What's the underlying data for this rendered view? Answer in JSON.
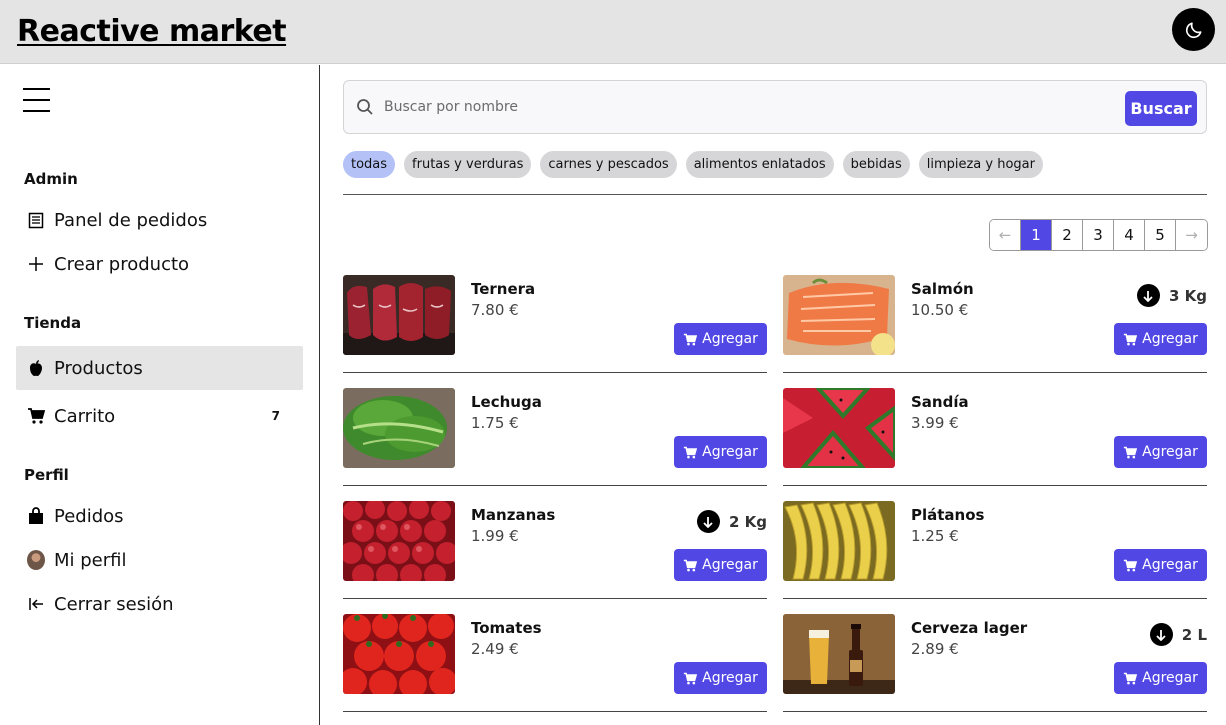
{
  "app": {
    "brand": "Reactive market"
  },
  "header": {
    "theme_toggle_icon": "moon-icon"
  },
  "sidebar": {
    "sections": [
      {
        "title": "Admin",
        "items": [
          {
            "label": "Panel de pedidos",
            "icon": "receipt-icon"
          },
          {
            "label": "Crear producto",
            "icon": "plus-icon"
          }
        ]
      },
      {
        "title": "Tienda",
        "items": [
          {
            "label": "Productos",
            "icon": "apple-icon",
            "active": true
          },
          {
            "label": "Carrito",
            "icon": "cart-icon",
            "badge": "7"
          }
        ]
      },
      {
        "title": "Perfil",
        "items": [
          {
            "label": "Pedidos",
            "icon": "bag-icon"
          },
          {
            "label": "Mi perfil",
            "icon": "avatar"
          },
          {
            "label": "Cerrar sesión",
            "icon": "logout-icon"
          }
        ]
      }
    ]
  },
  "search": {
    "placeholder": "Buscar por nombre",
    "value": "",
    "button_label": "Buscar"
  },
  "filters": {
    "chips": [
      "todas",
      "frutas y verduras",
      "carnes y pescados",
      "alimentos enlatados",
      "bebidas",
      "limpieza y hogar"
    ],
    "active": "todas"
  },
  "pagination": {
    "prev": "←",
    "pages": [
      "1",
      "2",
      "3",
      "4",
      "5"
    ],
    "current": "1",
    "next": "→"
  },
  "products": [
    {
      "name": "Ternera",
      "price": "7.80 €",
      "qty": "",
      "add_label": "Agregar",
      "image": "beef"
    },
    {
      "name": "Salmón",
      "price": "10.50 €",
      "qty": "3 Kg",
      "add_label": "Agregar",
      "image": "salmon"
    },
    {
      "name": "Lechuga",
      "price": "1.75 €",
      "qty": "",
      "add_label": "Agregar",
      "image": "lettuce"
    },
    {
      "name": "Sandía",
      "price": "3.99 €",
      "qty": "",
      "add_label": "Agregar",
      "image": "watermelon"
    },
    {
      "name": "Manzanas",
      "price": "1.99 €",
      "qty": "2 Kg",
      "add_label": "Agregar",
      "image": "apples"
    },
    {
      "name": "Plátanos",
      "price": "1.25 €",
      "qty": "",
      "add_label": "Agregar",
      "image": "bananas"
    },
    {
      "name": "Tomates",
      "price": "2.49 €",
      "qty": "",
      "add_label": "Agregar",
      "image": "tomatoes"
    },
    {
      "name": "Cerveza lager",
      "price": "2.89 €",
      "qty": "2 L",
      "add_label": "Agregar",
      "image": "beer"
    }
  ],
  "colors": {
    "accent": "#5147e5",
    "chip_active": "#b3c1f7",
    "chip": "#d6d6d9",
    "header_bg": "#e4e4e4"
  }
}
